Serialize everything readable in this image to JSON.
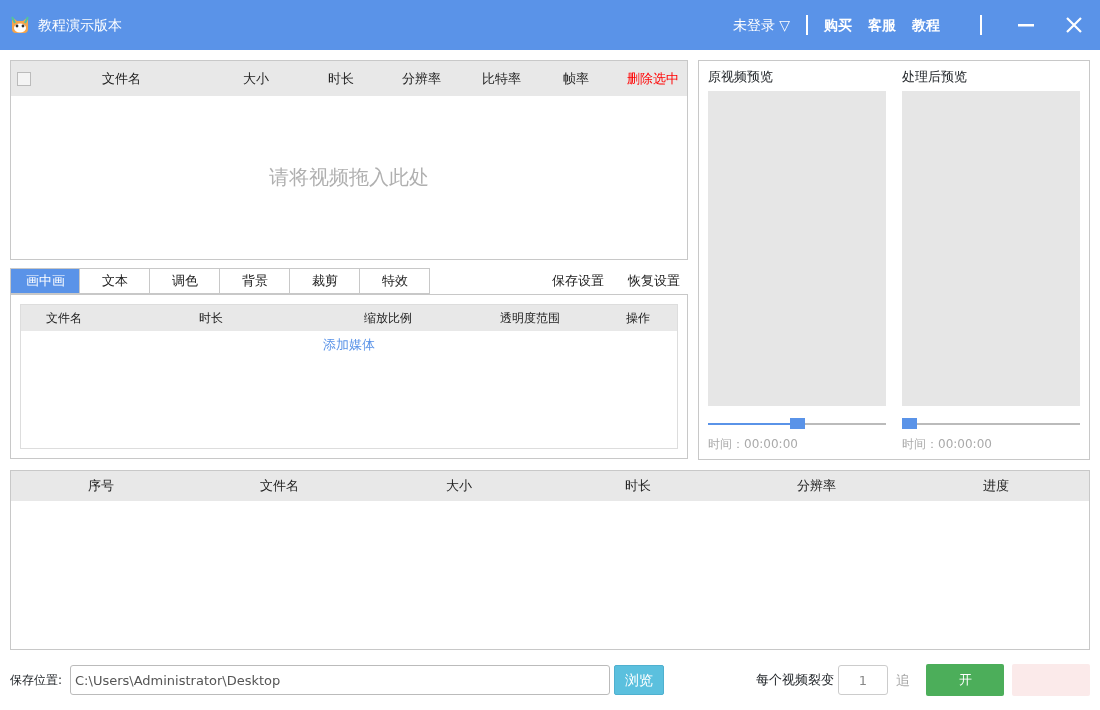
{
  "window": {
    "title": "教程演示版本",
    "account": "未登录 ▽",
    "links": [
      "购买",
      "客服",
      "教程"
    ]
  },
  "file_table": {
    "select_all": {
      "checked": false
    },
    "columns": [
      "文件名",
      "大小",
      "时长",
      "分辨率",
      "比特率",
      "帧率"
    ],
    "delete_action": "删除选中",
    "empty_hint": "请将视频拖入此处"
  },
  "tabs": [
    {
      "label": "画中画",
      "selected": true
    },
    {
      "label": "文本",
      "selected": false
    },
    {
      "label": "调色",
      "selected": false
    },
    {
      "label": "背景",
      "selected": false
    },
    {
      "label": "裁剪",
      "selected": false
    },
    {
      "label": "特效",
      "selected": false
    }
  ],
  "settings_actions": [
    "保存设置",
    "恢复设置"
  ],
  "media_table": {
    "columns": [
      "文件名",
      "时长",
      "缩放比例",
      "透明度范围",
      "操作"
    ],
    "add_link": "添加媒体"
  },
  "previews": [
    {
      "title": "原视频预览",
      "level": 0.5,
      "time": "时间：00:00:00"
    },
    {
      "title": "处理后预览",
      "level": 0,
      "time": "时间：00:00:00"
    }
  ],
  "task_table": {
    "columns": [
      "序号",
      "文件名",
      "大小",
      "时长",
      "分辨率",
      "进度"
    ]
  },
  "footer": {
    "save_label": "保存位置:",
    "save_path": "C:\\Users\\Administrator\\Desktop",
    "browse": "浏览",
    "split_label": "每个视频裂变",
    "split_count": "1",
    "append_label": "追",
    "start_button": "开"
  }
}
